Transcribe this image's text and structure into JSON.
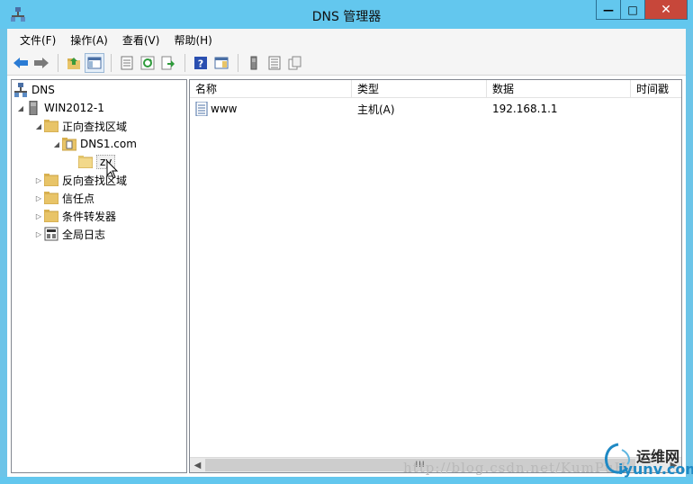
{
  "window": {
    "title": "DNS 管理器",
    "min_glyph": "—",
    "max_glyph": "□",
    "close_glyph": "✕"
  },
  "menu": [
    "文件(F)",
    "操作(A)",
    "查看(V)",
    "帮助(H)"
  ],
  "toolbar": {
    "icons": [
      "back-icon",
      "forward-icon",
      "up-folder-icon",
      "show-hide-tree-icon",
      "properties-icon",
      "refresh-icon",
      "export-icon",
      "help-icon",
      "action-pane-icon",
      "server-icon",
      "list-icon",
      "copy-icon"
    ]
  },
  "tree": {
    "root": "DNS",
    "server": "WIN2012-1",
    "forward_zones": "正向查找区域",
    "zone": "DNS1.com",
    "subfolder": "zy",
    "reverse_zones": "反向查找区域",
    "trust_points": "信任点",
    "conditional_forwarders": "条件转发器",
    "global_logs": "全局日志"
  },
  "list": {
    "columns": [
      "名称",
      "类型",
      "数据",
      "时间戳"
    ],
    "rows": [
      {
        "name": "www",
        "type": "主机(A)",
        "data": "192.168.1.1",
        "timestamp": ""
      }
    ]
  },
  "scrollbar": {
    "thumb_glyph": "III"
  },
  "watermark": "http://blog.csdn.net/KumPuH",
  "logo": {
    "cn": "运维网",
    "en": "iyunv.com"
  },
  "colors": {
    "titlebar": "#63c7ee",
    "close_button": "#c7473a",
    "folder": "#e8c468"
  }
}
